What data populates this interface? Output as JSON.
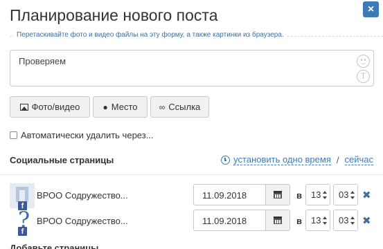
{
  "dialog": {
    "title": "Планирование нового поста",
    "close_label": "×"
  },
  "dropzone": {
    "hint": "Перетаскивайте фото и видео файлы на эту форму, а также картинки из браузера."
  },
  "composer": {
    "text": "Проверяем",
    "text_icon_label": "T"
  },
  "attach_buttons": {
    "photo_label": "Фото/видео",
    "place_label": "Место",
    "link_label": "Ссылка"
  },
  "auto_delete": {
    "label": "Автоматически удалить через...",
    "checked": false
  },
  "social": {
    "section_title": "Социальные страницы",
    "set_one_time_label": "установить одно время",
    "separator": "/",
    "now_label": "сейчас",
    "at_label": "в",
    "remove_label": "✖",
    "pages": [
      {
        "name": "ВРОО Содружество...",
        "network": "facebook",
        "network_label": "f",
        "avatar_label": "?",
        "date": "11.09.2018",
        "hour": "13",
        "minute": "03"
      },
      {
        "name": "ВРОО Содружество...",
        "network": "facebook",
        "network_label": "f",
        "avatar_label": "?",
        "date": "11.09.2018",
        "hour": "13",
        "minute": "03"
      }
    ]
  },
  "footer": {
    "add_pages_label": "Добавьте страницы"
  },
  "colors": {
    "accent": "#3d7bb6",
    "facebook": "#3b5998",
    "button_bg": "#f1f1f1"
  }
}
